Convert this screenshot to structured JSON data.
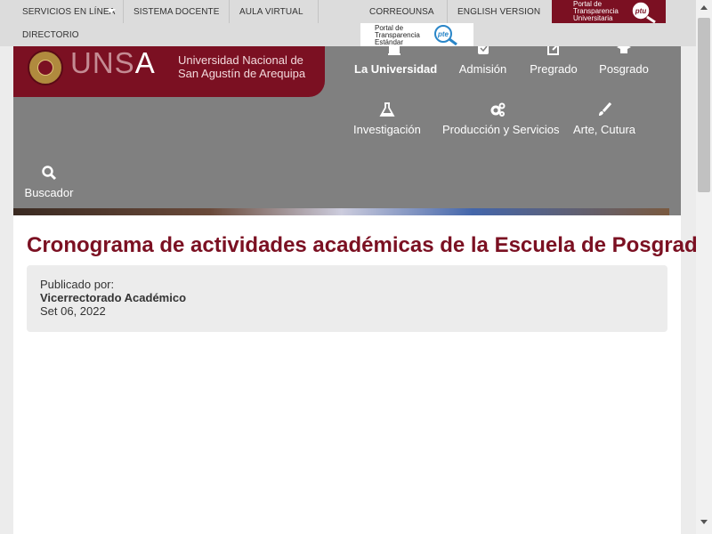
{
  "topbar": {
    "servicios": "SERVICIOS EN LÍNEA",
    "sistema_docente": "SISTEMA DOCENTE",
    "aula_virtual": "AULA VIRTUAL",
    "correounsa": "CORREOUNSA",
    "english": "ENGLISH VERSION",
    "directorio": "DIRECTORIO",
    "pte_text": "Portal de Transparencia Estándar",
    "pte_badge": "pte",
    "ptu_text": "Portal de Transparencia Universitaria",
    "ptu_badge": "ptu"
  },
  "brand": {
    "wordmark_main": "UNS",
    "wordmark_last": "A",
    "name_line1": "Universidad Nacional de",
    "name_line2": "San Agustín de Arequipa"
  },
  "nav": {
    "items": [
      {
        "label": "La Universidad",
        "icon": "building-icon",
        "active": true
      },
      {
        "label": "Admisión",
        "icon": "admission-icon"
      },
      {
        "label": "Pregrado",
        "icon": "edit-icon"
      },
      {
        "label": "Posgrado",
        "icon": "graduation-icon"
      },
      {
        "label": "Investigación",
        "icon": "flask-icon"
      },
      {
        "label": "Producción y Servicios",
        "icon": "gears-icon"
      },
      {
        "label": "Arte, Cutura",
        "icon": "brush-icon"
      }
    ],
    "search_label": "Buscador"
  },
  "article": {
    "title": "Cronograma de actividades académicas de la Escuela de Posgrado",
    "published_by_label": "Publicado por:",
    "author": "Vicerrectorado Académico",
    "date": "Set 06, 2022"
  },
  "colors": {
    "brand": "#7b1022",
    "header_gray": "#808080",
    "topbar_gray": "#dcdcdc"
  }
}
